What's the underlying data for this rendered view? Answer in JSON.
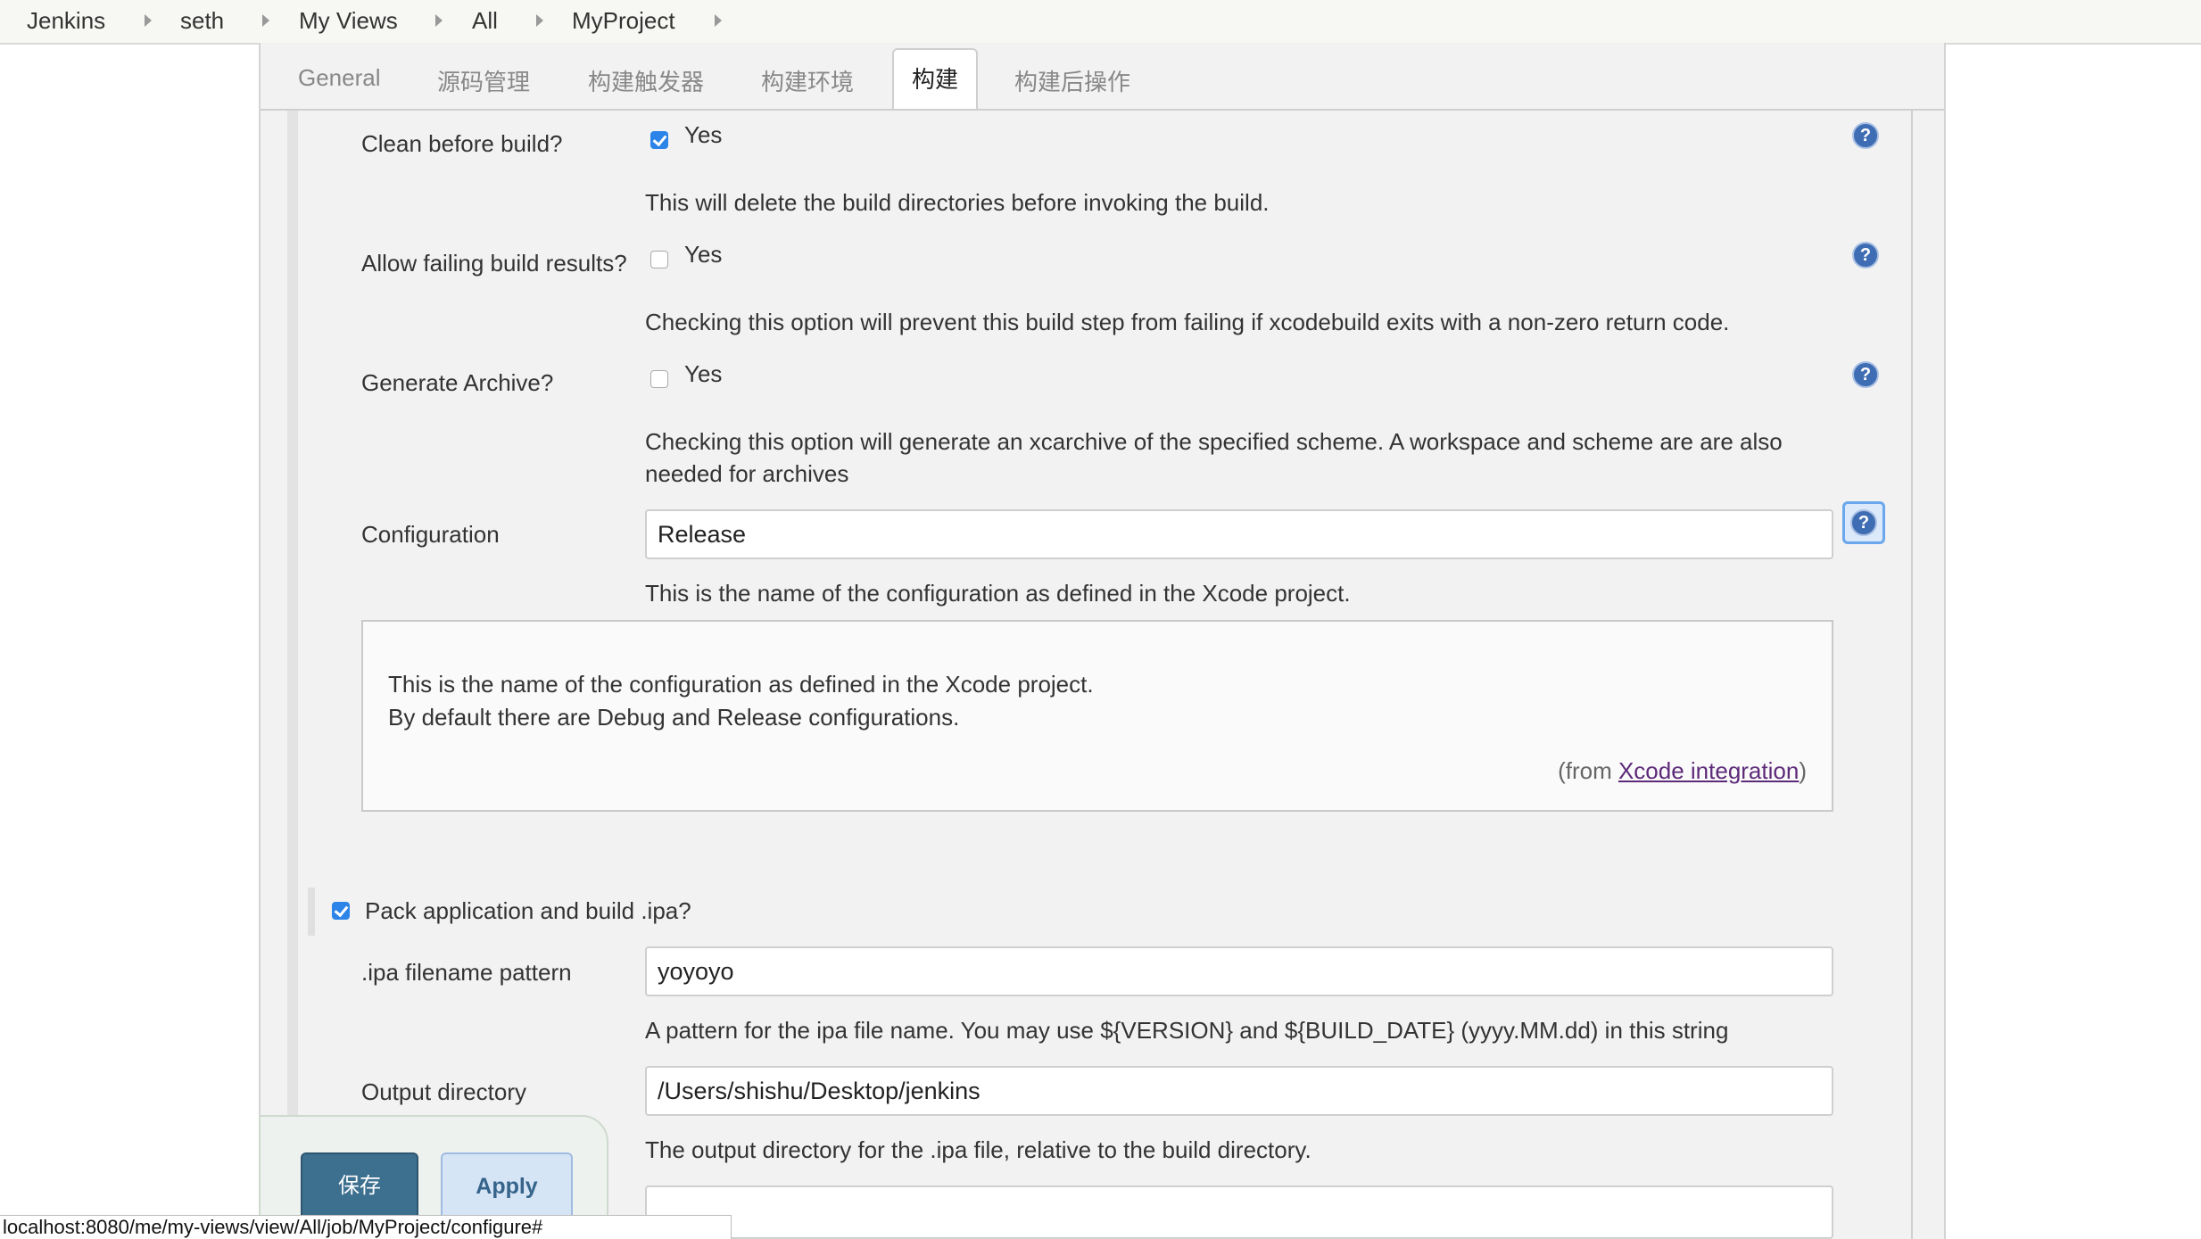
{
  "breadcrumb": [
    "Jenkins",
    "seth",
    "My Views",
    "All",
    "MyProject"
  ],
  "tabs": [
    "General",
    "源码管理",
    "构建触发器",
    "构建环境",
    "构建",
    "构建后操作"
  ],
  "active_tab": "构建",
  "fields": {
    "clean": {
      "label": "Clean before build?",
      "checkbox_label": "Yes",
      "checked": true,
      "description": "This will delete the build directories before invoking the build."
    },
    "allow_failing": {
      "label": "Allow failing build results?",
      "checkbox_label": "Yes",
      "checked": false,
      "description": "Checking this option will prevent this build step from failing if xcodebuild exits with a non-zero return code."
    },
    "archive": {
      "label": "Generate Archive?",
      "checkbox_label": "Yes",
      "checked": false,
      "description_line1": "Checking this option will generate an xcarchive of the specified scheme. A workspace and scheme are are also",
      "description_line2": "needed for archives"
    },
    "configuration": {
      "label": "Configuration",
      "value": "Release",
      "description": "This is the name of the configuration as defined in the Xcode project."
    },
    "pack_ipa": {
      "label": "Pack application and build .ipa?",
      "checked": true
    },
    "ipa_pattern": {
      "label": ".ipa filename pattern",
      "value": "yoyoyo",
      "description": "A pattern for the ipa file name. You may use ${VERSION} and ${BUILD_DATE} (yyyy.MM.dd) in this string"
    },
    "output_dir": {
      "label": "Output directory",
      "value": "/Users/shishu/Desktop/jenkins",
      "description": "The output directory for the .ipa file, relative to the build directory."
    }
  },
  "help_box": {
    "line1": "This is the name of the configuration as defined in the Xcode project.",
    "line2": "By default there are Debug and Release configurations.",
    "from_prefix": "(from ",
    "from_link": "Xcode integration",
    "from_suffix": ")"
  },
  "help_icon_glyph": "?",
  "buttons": {
    "save": "保存",
    "apply": "Apply"
  },
  "status_url": "localhost:8080/me/my-views/view/All/job/MyProject/configure#",
  "colors": {
    "checkbox_checked": "#2c84e8",
    "help_icon": "#3f6db4",
    "save_button": "#3d6f8f",
    "link": "#5d2a79"
  }
}
